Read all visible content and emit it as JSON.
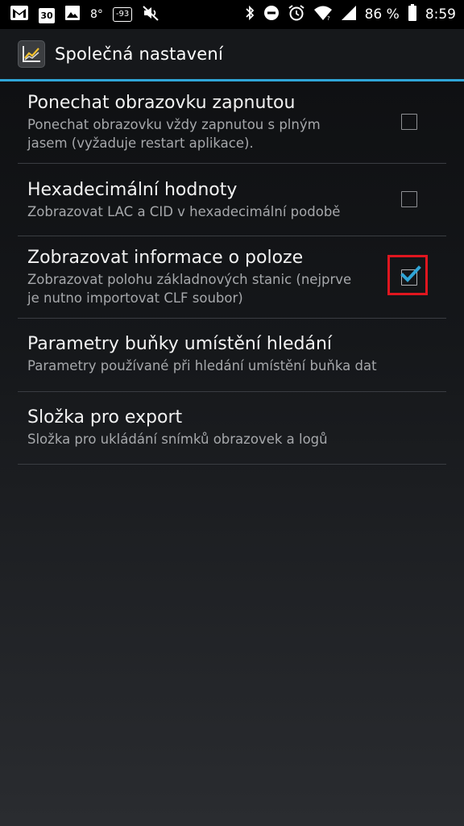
{
  "status_bar": {
    "day": "30",
    "temperature": "8°",
    "signal_value": "-93",
    "battery": "86 %",
    "time": "8:59",
    "left_icons": [
      "gmail-icon",
      "calendar-icon",
      "image-icon",
      "mute-icon"
    ],
    "right_icons": [
      "bluetooth-icon",
      "do-not-disturb-icon",
      "alarm-icon",
      "wifi-icon",
      "cell-signal-icon",
      "battery-icon"
    ]
  },
  "action_bar": {
    "title": "Společná nastavení",
    "icon": "chart-line-icon"
  },
  "colors": {
    "accent": "#2fa5d7",
    "check": "#2fa5d7",
    "highlight": "#e0161f"
  },
  "preferences": [
    {
      "title": "Ponechat obrazovku zapnutou",
      "summary_lines": [
        "Ponechat obrazovku vždy zapnutou s plným",
        "jasem (vyžaduje restart aplikace)."
      ],
      "checkbox": true,
      "checked": false
    },
    {
      "title": "Hexadecimální hodnoty",
      "summary_lines": [
        "Zobrazovat LAC a CID v hexadecimální podobě"
      ],
      "checkbox": true,
      "checked": false
    },
    {
      "title": "Zobrazovat informace o poloze",
      "summary_lines": [
        "Zobrazovat polohu základnových stanic (nejprve",
        "je nutno importovat CLF soubor)"
      ],
      "checkbox": true,
      "checked": true,
      "highlighted": true
    },
    {
      "title": "Parametry buňky umístění hledání",
      "summary_lines": [
        "Parametry používané při hledání umístění buňka dat"
      ],
      "checkbox": false
    },
    {
      "title": "Složka pro export",
      "summary_lines": [
        "Složka pro ukládání snímků obrazovek a logů"
      ],
      "checkbox": false
    }
  ]
}
